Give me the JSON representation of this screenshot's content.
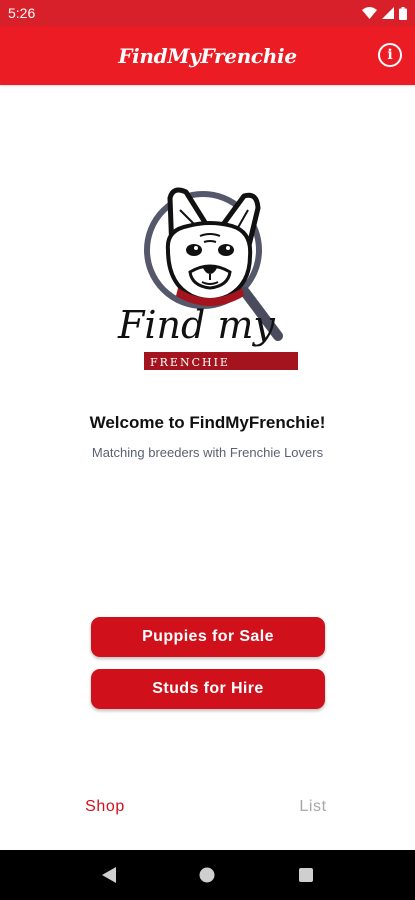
{
  "status_bar": {
    "time": "5:26"
  },
  "app_bar": {
    "title": "FindMyFrenchie"
  },
  "logo": {
    "script_text": "Find my",
    "banner_text": "FRENCHIE"
  },
  "main": {
    "welcome": "Welcome to FindMyFrenchie!",
    "subtitle": "Matching breeders with Frenchie Lovers",
    "buttons": {
      "puppies": "Puppies for Sale",
      "studs": "Studs for Hire"
    }
  },
  "bottom_nav": {
    "shop": "Shop",
    "list": "List"
  },
  "colors": {
    "primary": "#ec1c24",
    "button": "#d0111c",
    "status_bar": "#d8202a",
    "inactive": "#a7a7a7"
  }
}
